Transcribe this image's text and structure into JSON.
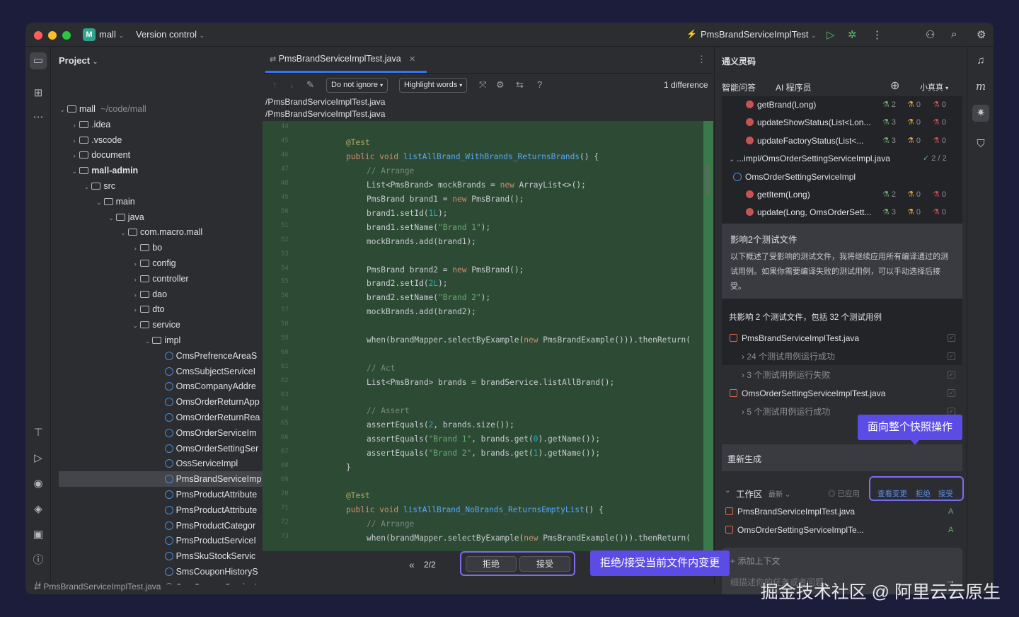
{
  "titlebar": {
    "project_badge": "M",
    "project_name": "mall",
    "vcs": "Version control",
    "run_config": "PmsBrandServiceImplTest"
  },
  "project_panel": {
    "title": "Project",
    "tree": [
      {
        "label": "mall",
        "hint": "~/code/mall",
        "indent": 0,
        "kind": "folder",
        "open": true
      },
      {
        "label": ".idea",
        "indent": 1,
        "kind": "folder"
      },
      {
        "label": ".vscode",
        "indent": 1,
        "kind": "folder"
      },
      {
        "label": "document",
        "indent": 1,
        "kind": "folder"
      },
      {
        "label": "mall-admin",
        "indent": 1,
        "kind": "folder",
        "open": true,
        "bold": true
      },
      {
        "label": "src",
        "indent": 2,
        "kind": "folder",
        "open": true
      },
      {
        "label": "main",
        "indent": 3,
        "kind": "folder",
        "open": true
      },
      {
        "label": "java",
        "indent": 4,
        "kind": "folder",
        "open": true
      },
      {
        "label": "com.macro.mall",
        "indent": 5,
        "kind": "pkg",
        "open": true
      },
      {
        "label": "bo",
        "indent": 6,
        "kind": "pkg"
      },
      {
        "label": "config",
        "indent": 6,
        "kind": "pkg"
      },
      {
        "label": "controller",
        "indent": 6,
        "kind": "pkg"
      },
      {
        "label": "dao",
        "indent": 6,
        "kind": "pkg"
      },
      {
        "label": "dto",
        "indent": 6,
        "kind": "pkg"
      },
      {
        "label": "service",
        "indent": 6,
        "kind": "pkg",
        "open": true
      },
      {
        "label": "impl",
        "indent": 7,
        "kind": "pkg",
        "open": true
      },
      {
        "label": "CmsPrefrenceAreaS",
        "indent": 8,
        "kind": "class"
      },
      {
        "label": "CmsSubjectServiceI",
        "indent": 8,
        "kind": "class"
      },
      {
        "label": "OmsCompanyAddre",
        "indent": 8,
        "kind": "class"
      },
      {
        "label": "OmsOrderReturnApp",
        "indent": 8,
        "kind": "class"
      },
      {
        "label": "OmsOrderReturnRea",
        "indent": 8,
        "kind": "class"
      },
      {
        "label": "OmsOrderServiceIm",
        "indent": 8,
        "kind": "class"
      },
      {
        "label": "OmsOrderSettingSer",
        "indent": 8,
        "kind": "class"
      },
      {
        "label": "OssServiceImpl",
        "indent": 8,
        "kind": "class"
      },
      {
        "label": "PmsBrandServiceImp",
        "indent": 8,
        "kind": "class",
        "selected": true
      },
      {
        "label": "PmsProductAttribute",
        "indent": 8,
        "kind": "class"
      },
      {
        "label": "PmsProductAttribute",
        "indent": 8,
        "kind": "class"
      },
      {
        "label": "PmsProductCategor",
        "indent": 8,
        "kind": "class"
      },
      {
        "label": "PmsProductServiceI",
        "indent": 8,
        "kind": "class"
      },
      {
        "label": "PmsSkuStockServic",
        "indent": 8,
        "kind": "class"
      },
      {
        "label": "SmsCouponHistoryS",
        "indent": 8,
        "kind": "class"
      },
      {
        "label": "SmsCouponServiceI",
        "indent": 8,
        "kind": "class"
      }
    ]
  },
  "editor": {
    "tab_label": "PmsBrandServiceImplTest.java",
    "diff_toolbar": {
      "ignore_select": "Do not ignore",
      "highlight_select": "Highlight words",
      "difference_count": "1 difference"
    },
    "paths": [
      "/PmsBrandServiceImplTest.java",
      "/PmsBrandServiceImplTest.java"
    ],
    "line_numbers": [
      "44",
      "45",
      "46",
      "47",
      "48",
      "49",
      "50",
      "51",
      "52",
      "53",
      "54",
      "55",
      "56",
      "57",
      "58",
      "59",
      "60",
      "61",
      "62",
      "63",
      "64",
      "65",
      "66",
      "67",
      "68",
      "69",
      "70",
      "71",
      "72",
      "73"
    ],
    "code_lines": [
      [],
      [
        {
          "t": "@Test",
          "c": "ann",
          "i": 0
        }
      ],
      [
        {
          "t": "public void ",
          "c": "kw",
          "i": 0
        },
        {
          "t": "listAllBrand_WithBrands_ReturnsBrands",
          "c": "fn"
        },
        {
          "t": "() {",
          "c": ""
        }
      ],
      [
        {
          "t": "// Arrange",
          "c": "cm",
          "i": 1
        }
      ],
      [
        {
          "t": "List<PmsBrand> mockBrands = ",
          "c": "",
          "i": 1
        },
        {
          "t": "new ",
          "c": "kw"
        },
        {
          "t": "ArrayList<>();",
          "c": ""
        }
      ],
      [
        {
          "t": "PmsBrand brand1 = ",
          "c": "",
          "i": 1
        },
        {
          "t": "new ",
          "c": "kw"
        },
        {
          "t": "PmsBrand();",
          "c": ""
        }
      ],
      [
        {
          "t": "brand1.setId(",
          "c": "",
          "i": 1
        },
        {
          "t": "1L",
          "c": "num"
        },
        {
          "t": ");",
          "c": ""
        }
      ],
      [
        {
          "t": "brand1.setName(",
          "c": "",
          "i": 1
        },
        {
          "t": "\"Brand 1\"",
          "c": "str"
        },
        {
          "t": ");",
          "c": ""
        }
      ],
      [
        {
          "t": "mockBrands.add(brand1);",
          "c": "",
          "i": 1
        }
      ],
      [],
      [
        {
          "t": "PmsBrand brand2 = ",
          "c": "",
          "i": 1
        },
        {
          "t": "new ",
          "c": "kw"
        },
        {
          "t": "PmsBrand();",
          "c": ""
        }
      ],
      [
        {
          "t": "brand2.setId(",
          "c": "",
          "i": 1
        },
        {
          "t": "2L",
          "c": "num"
        },
        {
          "t": ");",
          "c": ""
        }
      ],
      [
        {
          "t": "brand2.setName(",
          "c": "",
          "i": 1
        },
        {
          "t": "\"Brand 2\"",
          "c": "str"
        },
        {
          "t": ");",
          "c": ""
        }
      ],
      [
        {
          "t": "mockBrands.add(brand2);",
          "c": "",
          "i": 1
        }
      ],
      [],
      [
        {
          "t": "when(brandMapper.selectByExample(",
          "c": "",
          "i": 1
        },
        {
          "t": "new ",
          "c": "kw"
        },
        {
          "t": "PmsBrandExample())).thenReturn(",
          "c": ""
        }
      ],
      [],
      [
        {
          "t": "// Act",
          "c": "cm",
          "i": 1
        }
      ],
      [
        {
          "t": "List<PmsBrand> brands = brandService.listAllBrand();",
          "c": "",
          "i": 1
        }
      ],
      [],
      [
        {
          "t": "// Assert",
          "c": "cm",
          "i": 1
        }
      ],
      [
        {
          "t": "assertEquals(",
          "c": "",
          "i": 1
        },
        {
          "t": "2",
          "c": "num"
        },
        {
          "t": ", brands.size());",
          "c": ""
        }
      ],
      [
        {
          "t": "assertEquals(",
          "c": "",
          "i": 1
        },
        {
          "t": "\"Brand 1\"",
          "c": "str"
        },
        {
          "t": ", brands.get(",
          "c": ""
        },
        {
          "t": "0",
          "c": "num"
        },
        {
          "t": ").getName());",
          "c": ""
        }
      ],
      [
        {
          "t": "assertEquals(",
          "c": "",
          "i": 1
        },
        {
          "t": "\"Brand 2\"",
          "c": "str"
        },
        {
          "t": ", brands.get(",
          "c": ""
        },
        {
          "t": "1",
          "c": "num"
        },
        {
          "t": ").getName());",
          "c": ""
        }
      ],
      [
        {
          "t": "}",
          "c": "",
          "i": 0
        }
      ],
      [],
      [
        {
          "t": "@Test",
          "c": "ann",
          "i": 0
        }
      ],
      [
        {
          "t": "public void ",
          "c": "kw",
          "i": 0
        },
        {
          "t": "listAllBrand_NoBrands_ReturnsEmptyList",
          "c": "fn"
        },
        {
          "t": "() {",
          "c": ""
        }
      ],
      [
        {
          "t": "// Arrange",
          "c": "cm",
          "i": 1
        }
      ],
      [
        {
          "t": "when(brandMapper.selectByExample(",
          "c": "",
          "i": 1
        },
        {
          "t": "new ",
          "c": "kw"
        },
        {
          "t": "PmsBrandExample())).thenReturn(",
          "c": ""
        }
      ]
    ],
    "pager": "2/2",
    "reject_label": "拒绝",
    "accept_label": "接受",
    "callout_file": "拒绝/接受当前文件内变更"
  },
  "status_bar": {
    "path": "PmsBrandServiceImplTest.java"
  },
  "ai_panel": {
    "title": "通义灵码",
    "tabs": [
      "智能问答",
      "AI 程序员"
    ],
    "model": "小真真",
    "methods": [
      {
        "kind": "m",
        "label": "getBrand(Long)",
        "s": [
          "2",
          "0",
          "0"
        ]
      },
      {
        "kind": "m",
        "label": "updateShowStatus(List<Lon...",
        "s": [
          "3",
          "0",
          "0"
        ]
      },
      {
        "kind": "m",
        "label": "updateFactoryStatus(List<...",
        "s": [
          "3",
          "0",
          "0"
        ]
      },
      {
        "kind": "path",
        "label": "...impl/OmsOrderSettingServiceImpl.java",
        "count": "2 / 2"
      },
      {
        "kind": "c",
        "label": "OmsOrderSettingServiceImpl"
      },
      {
        "kind": "m",
        "label": "getItem(Long)",
        "s": [
          "2",
          "0",
          "0"
        ]
      },
      {
        "kind": "m",
        "label": "update(Long, OmsOrderSett...",
        "s": [
          "3",
          "0",
          "0"
        ]
      }
    ],
    "info_title": "影响2个测试文件",
    "info_text": "以下概述了受影响的测试文件，我将继续应用所有编译通过的测试用例。如果你需要编译失败的测试用例，可以手动选择后接受。",
    "summary": "共影响 2 个测试文件，包括 32 个测试用例",
    "test_rows": [
      {
        "label": "PmsBrandServiceImplTest.java",
        "file": true
      },
      {
        "label": "24 个测试用例运行成功",
        "file": false
      },
      {
        "label": "3 个测试用例运行失败",
        "file": false
      },
      {
        "label": "OmsOrderSettingServiceImplTest.java",
        "file": true
      },
      {
        "label": "5 个测试用例运行成功",
        "file": false
      }
    ],
    "regenerate": "重新生成",
    "callout_snapshot": "面向整个快照操作",
    "workspace": {
      "label": "工作区",
      "latest": "最新",
      "applied": "已应用",
      "view_changes": "查看变更",
      "reject": "拒绝",
      "accept": "接受"
    },
    "ws_files": [
      {
        "name": "PmsBrandServiceImplTest.java",
        "status": "A"
      },
      {
        "name": "OmsOrderSettingServiceImplTe...",
        "status": "A"
      }
    ],
    "add_context": "添加上下文",
    "input_placeholder": "细描述你的任务或者问题"
  },
  "watermark": "掘金技术社区 @ 阿里云云原生"
}
